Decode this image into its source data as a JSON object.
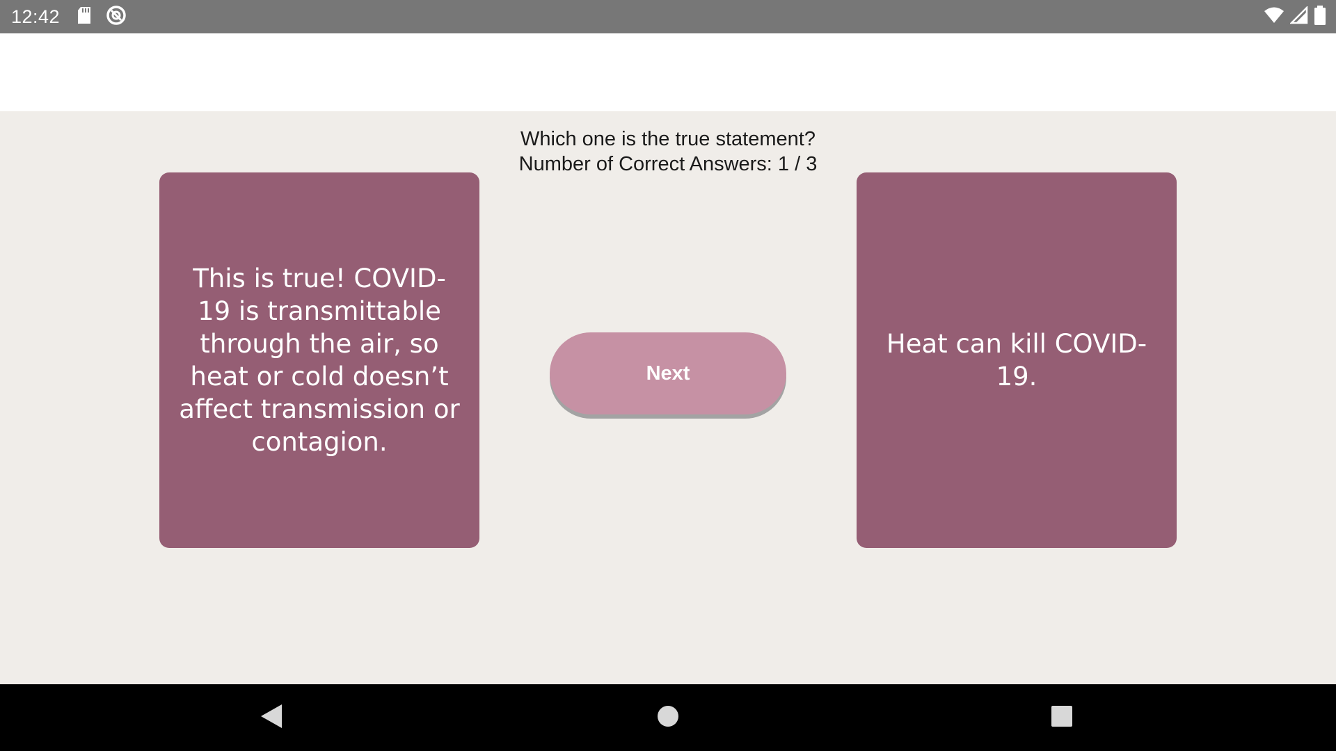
{
  "status_bar": {
    "time": "12:42",
    "left_icons": [
      "sd-card-icon",
      "data-saver-icon"
    ],
    "right_icons": [
      "wifi-icon",
      "signal-icon",
      "battery-icon"
    ]
  },
  "quiz": {
    "question": "Which one is the true statement?",
    "score_text": "Number of Correct Answers: 1 / 3",
    "left_card_text": "This is true! COVID-19 is transmittable through the air, so heat or cold doesn’t affect transmission or contagion.",
    "right_card_text": "Heat can kill COVID-19.",
    "next_label": "Next"
  },
  "colors": {
    "card": "#955e74",
    "button": "#c691a4",
    "background": "#f0ede9",
    "status_bar": "#777777"
  },
  "nav_bar": {
    "buttons": [
      "back-icon",
      "home-icon",
      "recents-icon"
    ]
  }
}
